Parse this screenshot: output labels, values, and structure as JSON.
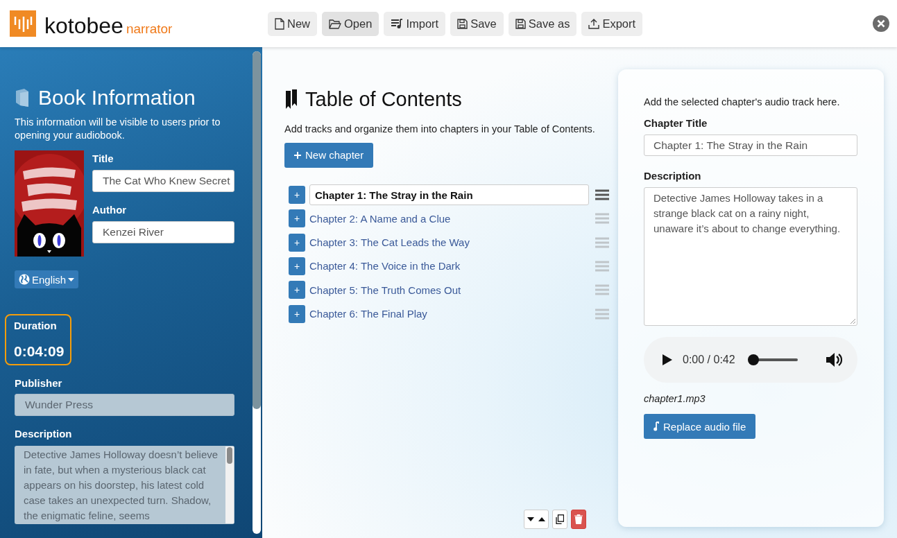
{
  "app": {
    "logo": "kotobee",
    "logo_sub": "narrator"
  },
  "toolbar": [
    {
      "label": "New",
      "kind": "file",
      "selected": false
    },
    {
      "label": "Open",
      "kind": "folder",
      "selected": true
    },
    {
      "label": "Import",
      "kind": "playlist",
      "selected": false
    },
    {
      "label": "Save",
      "kind": "disk",
      "selected": false
    },
    {
      "label": "Save as",
      "kind": "disk",
      "selected": false
    },
    {
      "label": "Export",
      "kind": "upload",
      "selected": false
    }
  ],
  "sidebar": {
    "heading": "Book Information",
    "intro": "This information will be visible to users prior to opening your audiobook.",
    "title_label": "Title",
    "title_value": "The Cat Who Knew Secret",
    "author_label": "Author",
    "author_value": "Kenzei River",
    "language": "English",
    "duration_label": "Duration",
    "duration": "0:04:09",
    "publisher_label": "Publisher",
    "publisher_value": "Wunder Press",
    "description_label": "Description",
    "description_value": "Detective James Holloway doesn’t believe in fate, but when a mysterious black cat appears on his doorstep, his latest cold case takes an unexpected turn. Shadow, the enigmatic feline, seems"
  },
  "toc": {
    "heading": "Table of Contents",
    "intro": "Add tracks and organize them into chapters in your Table of Contents.",
    "new_button": "New chapter",
    "add_symbol": "+",
    "chapters": [
      {
        "title": "Chapter 1: The Stray in the Rain",
        "selected": true
      },
      {
        "title": "Chapter 2: A Name and a Clue",
        "selected": false
      },
      {
        "title": "Chapter 3: The Cat Leads the Way",
        "selected": false
      },
      {
        "title": "Chapter 4: The Voice in the Dark",
        "selected": false
      },
      {
        "title": "Chapter 5: The Truth Comes Out",
        "selected": false
      },
      {
        "title": "Chapter 6: The Final Play",
        "selected": false
      }
    ]
  },
  "details": {
    "intro": "Add the selected chapter's audio track here.",
    "chapter_title_label": "Chapter Title",
    "chapter_title_value": "Chapter 1: The Stray in the Rain",
    "description_label": "Description",
    "description_value": "Detective James Holloway takes in a strange black cat on a rainy night, unaware it’s about to change everything.",
    "player": {
      "time": "0:00 / 0:42",
      "level": 0
    },
    "file_name": "chapter1.mp3",
    "replace_button": "Replace audio file"
  }
}
